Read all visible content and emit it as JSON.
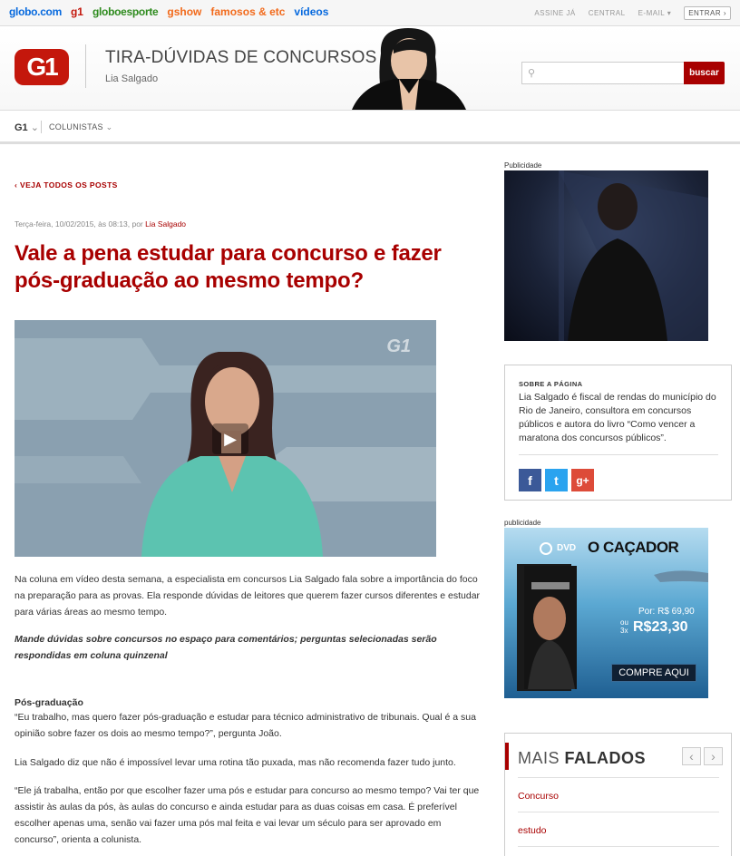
{
  "topbar": {
    "sites": [
      "globo.com",
      "g1",
      "globoesporte",
      "gshow",
      "famosos & etc",
      "vídeos"
    ],
    "assine": "ASSINE JÁ",
    "central": "CENTRAL",
    "email": "E-MAIL",
    "entrar": "ENTRAR"
  },
  "header": {
    "logo": "G1",
    "blog_title": "TIRA-DÚVIDAS DE CONCURSOS",
    "author": "Lia Salgado",
    "search_placeholder": "",
    "search_button": "buscar"
  },
  "nav": {
    "g1": "G1",
    "colunistas": "COLUNISTAS"
  },
  "article": {
    "back_link": "VEJA TODOS OS POSTS",
    "meta_prefix": "Terça-feira, 10/02/2015, às 08:13, por",
    "meta_author": "Lia Salgado",
    "title": "Vale a pena estudar para concurso e fazer pós-graduação ao mesmo tempo?",
    "video_watermark": "G1",
    "p1": "Na coluna em vídeo desta semana, a especialista em concursos Lia Salgado fala sobre a importância do foco na preparação para as provas. Ela responde dúvidas de leitores que querem fazer cursos diferentes e estudar para várias áreas ao mesmo tempo.",
    "p2": "Mande dúvidas sobre concursos no espaço para comentários; perguntas selecionadas serão respondidas em coluna quinzenal",
    "subhead": "Pós-graduação",
    "p3": "“Eu trabalho, mas quero fazer pós-graduação e estudar para técnico administrativo de tribunais. Qual é a sua opinião sobre fazer os dois ao mesmo tempo?”, pergunta João.",
    "p4": "Lia Salgado diz que não é impossível levar uma rotina tão puxada, mas não recomenda fazer tudo junto.",
    "p5": "“Ele já trabalha, então por que escolher fazer uma pós e estudar para concurso ao mesmo tempo? Vai ter que assistir às aulas da pós, às aulas do concurso e ainda estudar para as duas coisas em casa. É preferível escolher apenas uma, senão vai fazer uma pós mal feita e vai levar um século para ser aprovado em concurso”, orienta a colunista."
  },
  "sidebar": {
    "ad1_label": "Publicidade",
    "about_heading": "SOBRE A PÁGINA",
    "about_text": "Lia Salgado é fiscal de rendas do município do Rio de Janeiro, consultora em concursos públicos e autora do livro “Como vencer a maratona dos concursos públicos”.",
    "social": [
      {
        "icon": "facebook-icon",
        "glyph": "f",
        "color": "#3b5998"
      },
      {
        "icon": "twitter-icon",
        "glyph": "t",
        "color": "#2aa3ef"
      },
      {
        "icon": "google-plus-icon",
        "glyph": "g+",
        "color": "#dd4b39"
      }
    ],
    "ad2_label": "publicidade",
    "ad2": {
      "dvd": "DVD",
      "title": "O CAÇADOR",
      "price_por": "Por: R$ 69,90",
      "price_ou": "ou",
      "price_3x": "3x",
      "price_value": "R$23,30",
      "cta": "COMPRE AQUI"
    },
    "mais_falados": {
      "prefix": "MAIS",
      "bold": "FALADOS",
      "items": [
        "Concurso",
        "estudo"
      ]
    }
  }
}
